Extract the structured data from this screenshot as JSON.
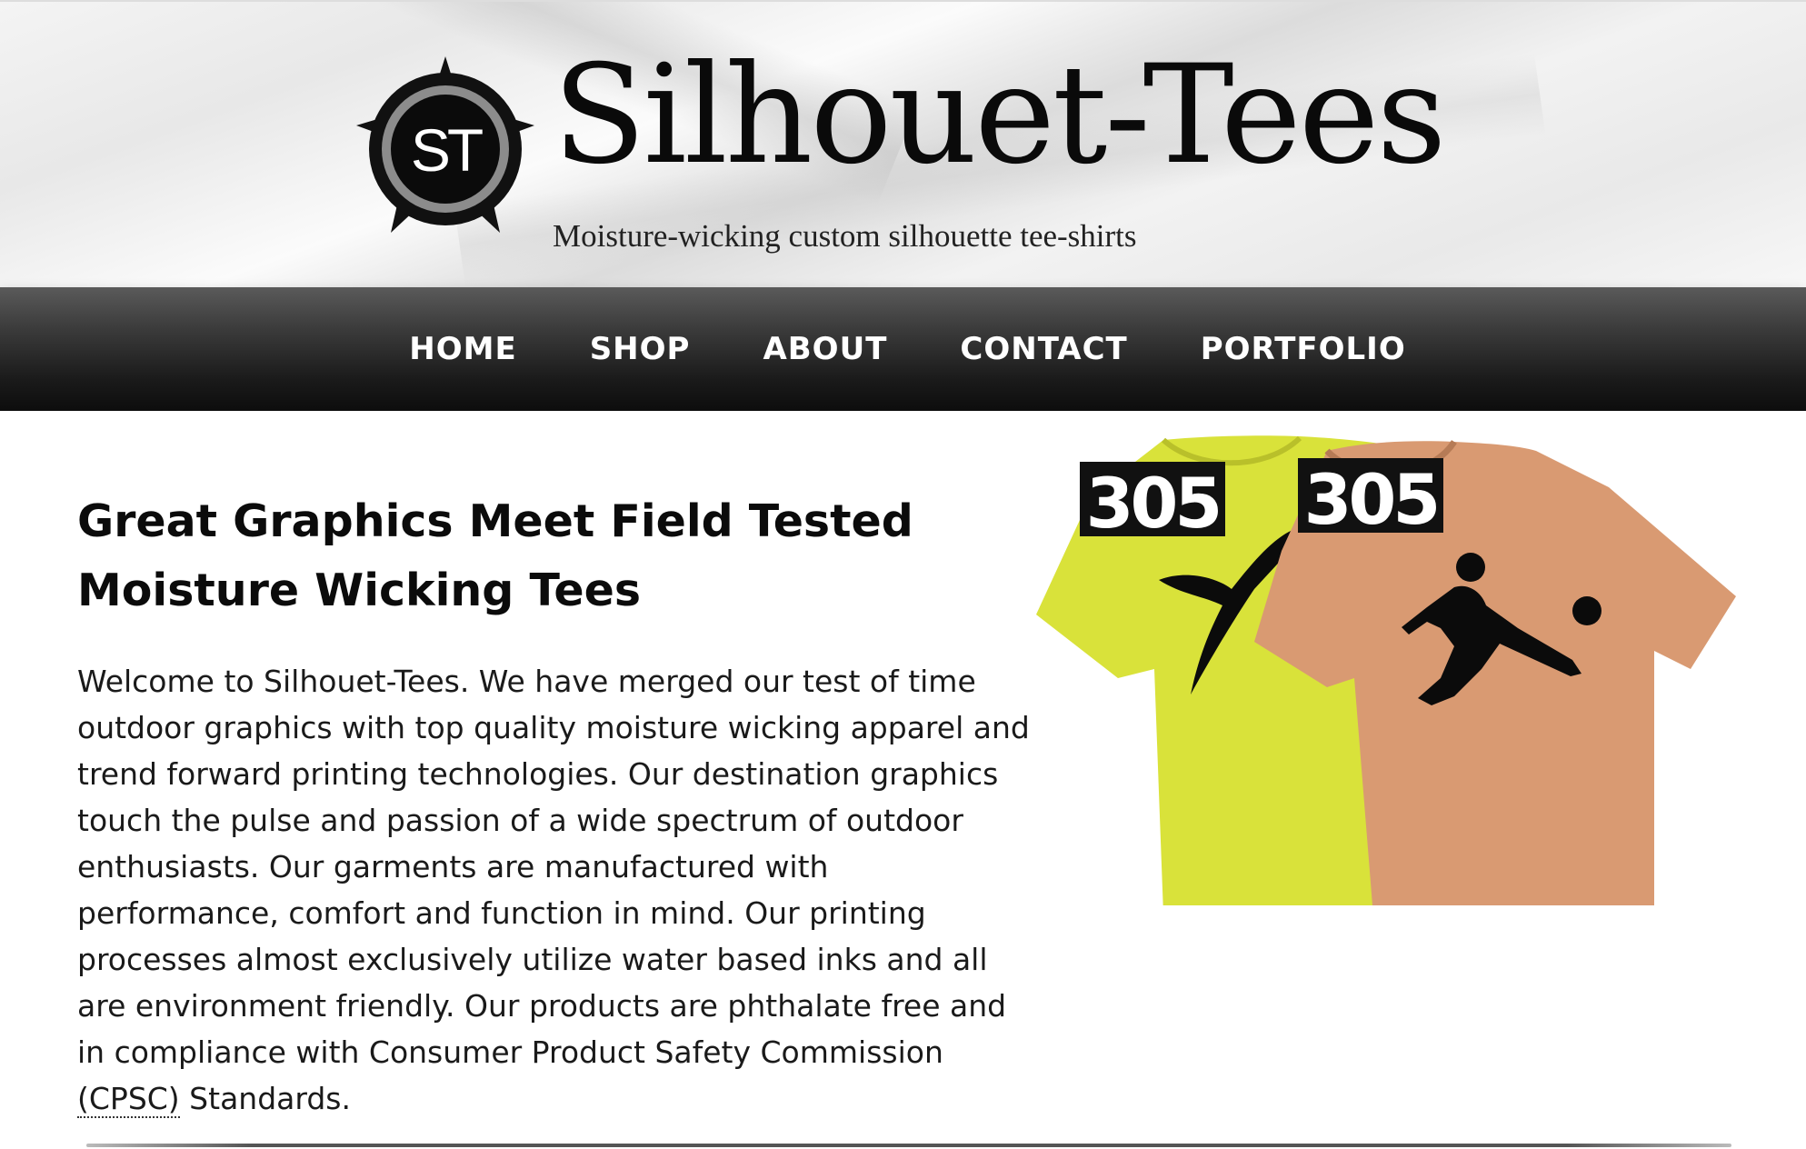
{
  "brand": {
    "name": "Silhouet-Tees",
    "tagline": "Moisture-wicking custom silhouette tee-shirts",
    "logo_letters": "ST"
  },
  "nav": {
    "items": [
      {
        "label": "HOME"
      },
      {
        "label": "SHOP"
      },
      {
        "label": "ABOUT"
      },
      {
        "label": "CONTACT"
      },
      {
        "label": "PORTFOLIO"
      }
    ]
  },
  "main": {
    "headline": "Great Graphics Meet Field Tested Moisture Wicking Tees",
    "intro_before": "Welcome to Silhouet-Tees. We have merged our test of time outdoor graphics with top quality moisture wicking apparel and trend forward printing technologies. Our destination graphics touch the pulse and passion of a wide spectrum of outdoor enthusiasts. Our garments are manufactured with performance, comfort and function in mind. Our printing processes almost exclusively utilize water based inks and all are environment friendly. Our products are phthalate free and in compliance with Consumer Product Safety Commission ",
    "intro_abbr": "(CPSC)",
    "intro_after": " Standards."
  },
  "product_image": {
    "shirt_left": {
      "badge": "305",
      "color": "#d9e23a"
    },
    "shirt_right": {
      "badge": "305",
      "color": "#d99a72"
    }
  },
  "colors": {
    "nav_bg": "#1a1a1a",
    "nav_text": "#ffffff",
    "page_bg": "#ffffff"
  }
}
